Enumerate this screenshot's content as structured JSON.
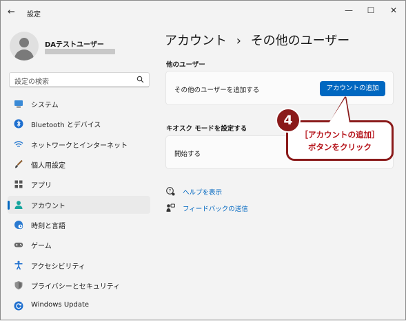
{
  "window": {
    "title": "設定",
    "back_glyph": "←",
    "min_glyph": "—",
    "max_glyph": "☐",
    "close_glyph": "✕"
  },
  "profile": {
    "name": "DAテストユーザー"
  },
  "search": {
    "placeholder": "設定の検索",
    "icon": "search-icon"
  },
  "sidebar": {
    "items": [
      {
        "label": "システム",
        "icon": "monitor-icon"
      },
      {
        "label": "Bluetooth とデバイス",
        "icon": "bluetooth-icon"
      },
      {
        "label": "ネットワークとインターネット",
        "icon": "wifi-icon"
      },
      {
        "label": "個人用設定",
        "icon": "brush-icon"
      },
      {
        "label": "アプリ",
        "icon": "apps-icon"
      },
      {
        "label": "アカウント",
        "icon": "person-icon",
        "active": true
      },
      {
        "label": "時刻と言語",
        "icon": "globe-clock-icon"
      },
      {
        "label": "ゲーム",
        "icon": "gamepad-icon"
      },
      {
        "label": "アクセシビリティ",
        "icon": "accessibility-icon"
      },
      {
        "label": "プライバシーとセキュリティ",
        "icon": "shield-icon"
      },
      {
        "label": "Windows Update",
        "icon": "update-icon"
      }
    ]
  },
  "main": {
    "breadcrumb_parent": "アカウント",
    "breadcrumb_sep": "›",
    "breadcrumb_current": "その他のユーザー",
    "other_users": {
      "heading": "他のユーザー",
      "row_text": "その他のユーザーを追加する",
      "button_label": "アカウントの追加"
    },
    "kiosk": {
      "heading": "キオスク モードを設定する",
      "row_text": "開始する"
    },
    "links": [
      {
        "label": "ヘルプを表示",
        "icon": "help-icon"
      },
      {
        "label": "フィードバックの送信",
        "icon": "feedback-icon"
      }
    ]
  },
  "annotation": {
    "badge": "4",
    "line1": "［アカウントの追加］",
    "line2": "ボタンをクリック"
  },
  "colors": {
    "accent": "#0067c0",
    "callout_border": "#8a1a1a",
    "callout_text": "#b5131a"
  }
}
